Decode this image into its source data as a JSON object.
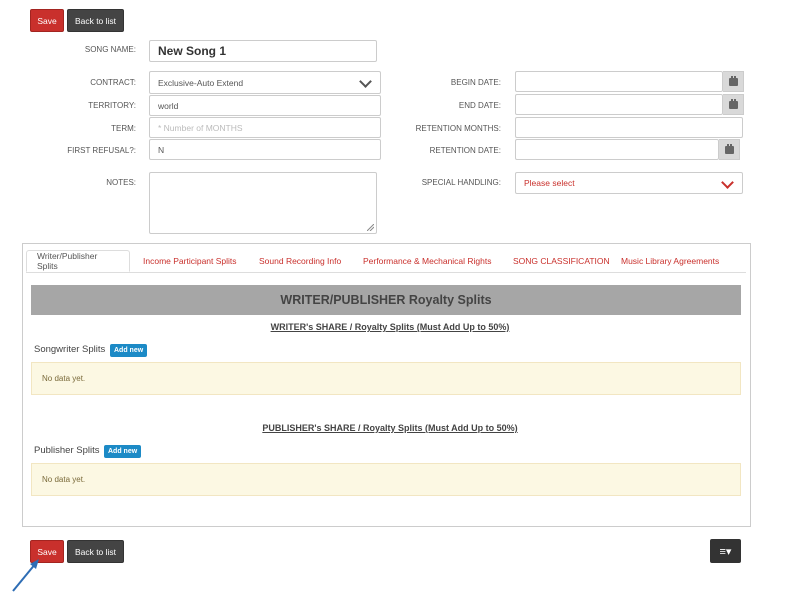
{
  "top_toolbar": {
    "save_label": "Save",
    "back_label": "Back to list"
  },
  "bottom_toolbar": {
    "save_label": "Save",
    "back_label": "Back to list",
    "menu_icon": "list-caret-icon"
  },
  "song": {
    "name_label": "SONG NAME:",
    "name_value": "New Song 1"
  },
  "fields": {
    "contract_label": "CONTRACT:",
    "contract_value": "Exclusive-Auto Extend",
    "territory_label": "TERRITORY:",
    "territory_value": "world",
    "term_label": "TERM:",
    "term_placeholder": "* Number of MONTHS",
    "first_refusal_label": "FIRST REFUSAL?:",
    "first_refusal_value": "N",
    "notes_label": "NOTES:",
    "begin_date_label": "BEGIN DATE:",
    "end_date_label": "END DATE:",
    "retention_months_label": "RETENTION MONTHS:",
    "retention_date_label": "RETENTION DATE:",
    "special_handling_label": "SPECIAL HANDLING:",
    "special_handling_value": "Please select"
  },
  "tabs": [
    {
      "label": "Writer/Publisher Splits"
    },
    {
      "label": "Income Participant Splits"
    },
    {
      "label": "Sound Recording Info"
    },
    {
      "label": "Performance & Mechanical Rights"
    },
    {
      "label": "SONG CLASSIFICATION"
    },
    {
      "label": "Music Library Agreements"
    }
  ],
  "splits": {
    "banner": "WRITER/PUBLISHER Royalty Splits",
    "writer_title": "WRITER's SHARE / Royalty Splits (Must Add Up to 50%)",
    "songwriter_label": "Songwriter Splits",
    "publisher_title": "PUBLISHER's SHARE / Royalty Splits (Must Add Up to 50%)",
    "publisher_label": "Publisher Splits",
    "add_new": "Add new",
    "empty_text": "No data yet."
  },
  "colors": {
    "save": "#c9302c",
    "back": "#444444",
    "add_new": "#1c8ac6",
    "tab_link": "#c9302c",
    "annotation_arrow": "#2e6db4"
  }
}
